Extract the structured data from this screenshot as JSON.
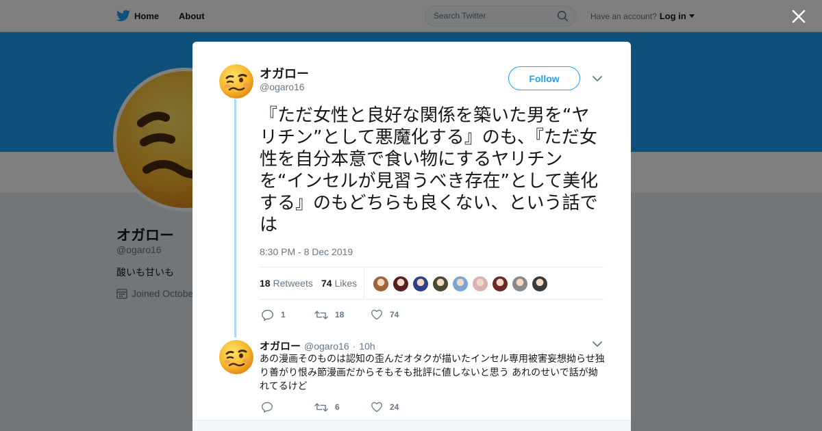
{
  "colors": {
    "brand": "#1da1f2",
    "thread_line": "#a8daf7",
    "muted": "#657786"
  },
  "topbar": {
    "home_label": "Home",
    "about_label": "About",
    "search_placeholder": "Search Twitter",
    "have_account": "Have an account?",
    "login_label": "Log in"
  },
  "profile": {
    "name": "オガロー",
    "handle": "@ogaro16",
    "bio": "酸いも甘いも",
    "joined": "Joined Octobe"
  },
  "tweet": {
    "author_name": "オガロー",
    "author_handle": "@ogaro16",
    "follow_label": "Follow",
    "text": "『ただ女性と良好な関係を築いた男を“ヤリチン”として悪魔化する』のも、『ただ女性を自分本意で食い物にするヤリチンを“インセルが見習うべき存在”として美化する』のもどちらも良くない、という話では",
    "timestamp": "8:30 PM - 8 Dec 2019",
    "retweets_count": "18",
    "retweets_label": "Retweets",
    "likes_count": "74",
    "likes_label": "Likes",
    "likers": [
      {
        "name": "liker-1",
        "color": "#a0643c"
      },
      {
        "name": "liker-2",
        "color": "#5a1e1e"
      },
      {
        "name": "liker-3",
        "color": "#2c3e8c"
      },
      {
        "name": "liker-4",
        "color": "#4b4b32"
      },
      {
        "name": "liker-5",
        "color": "#7aa6d6"
      },
      {
        "name": "liker-6",
        "color": "#d9b3b3"
      },
      {
        "name": "liker-7",
        "color": "#6b2a2a"
      },
      {
        "name": "liker-8",
        "color": "#8a8a8a"
      },
      {
        "name": "liker-9",
        "color": "#3a3a3a"
      }
    ],
    "reply_count": "1",
    "retweet_action_count": "18",
    "like_action_count": "74"
  },
  "reply": {
    "author_name": "オガロー",
    "author_handle": "@ogaro16",
    "separator": "·",
    "age": "10h",
    "text": "あの漫画そのものは認知の歪んだオタクが描いたインセル専用被害妄想拗らせ独り善がり恨み節漫画だからそもそも批評に値しないと思う あれのせいで話が拗れてるけど",
    "reply_count": "",
    "retweet_count": "6",
    "like_count": "24"
  }
}
